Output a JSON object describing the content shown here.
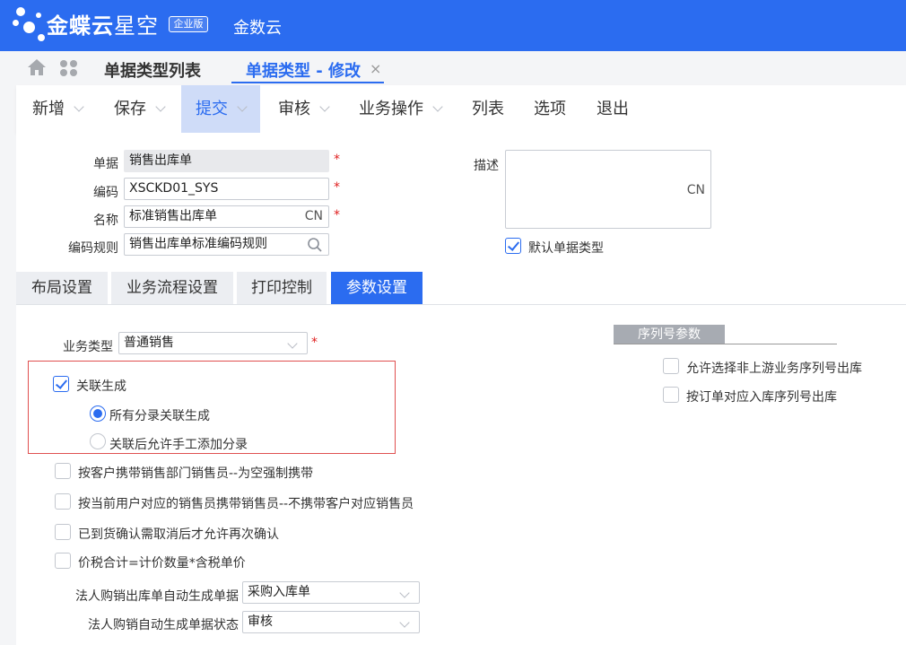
{
  "header": {
    "brand_bold": "金蝶云",
    "brand_thin": "星空",
    "edition": "企业版",
    "app_name": "金数云"
  },
  "tabs": {
    "list_tab": "单据类型列表",
    "edit_tab": "单据类型 - 修改",
    "close": "×"
  },
  "toolbar": {
    "new": "新增",
    "save": "保存",
    "submit": "提交",
    "audit": "审核",
    "business": "业务操作",
    "list": "列表",
    "options": "选项",
    "exit": "退出"
  },
  "form": {
    "doc_label": "单据",
    "doc_value": "销售出库单",
    "code_label": "编码",
    "code_value": "XSCKD01_SYS",
    "name_label": "名称",
    "name_value": "标准销售出库单",
    "name_lang": "CN",
    "rule_label": "编码规则",
    "rule_value": "销售出库单标准编码规则",
    "desc_label": "描述",
    "desc_lang": "CN",
    "default_type": "默认单据类型",
    "required": "*"
  },
  "subtabs": {
    "layout": "布局设置",
    "flow": "业务流程设置",
    "print": "打印控制",
    "params": "参数设置"
  },
  "params": {
    "biz_type_label": "业务类型",
    "biz_type_value": "普通销售",
    "link_generate": "关联生成",
    "all_entries": "所有分录关联生成",
    "allow_manual": "关联后允许手工添加分录",
    "opt1": "按客户携带销售部门销售员--为空强制携带",
    "opt2": "按当前用户对应的销售员携带销售员--不携带客户对应销售员",
    "opt3": "已到货确认需取消后才允许再次确认",
    "opt4": "价税合计=计价数量*含税单价",
    "legal_doc_label": "法人购销出库单自动生成单据",
    "legal_doc_value": "采购入库单",
    "legal_status_label": "法人购销自动生成单据状态",
    "legal_status_value": "审核"
  },
  "serial": {
    "title": "序列号参数",
    "opt1": "允许选择非上游业务序列号出库",
    "opt2": "按订单对应入库序列号出库"
  }
}
